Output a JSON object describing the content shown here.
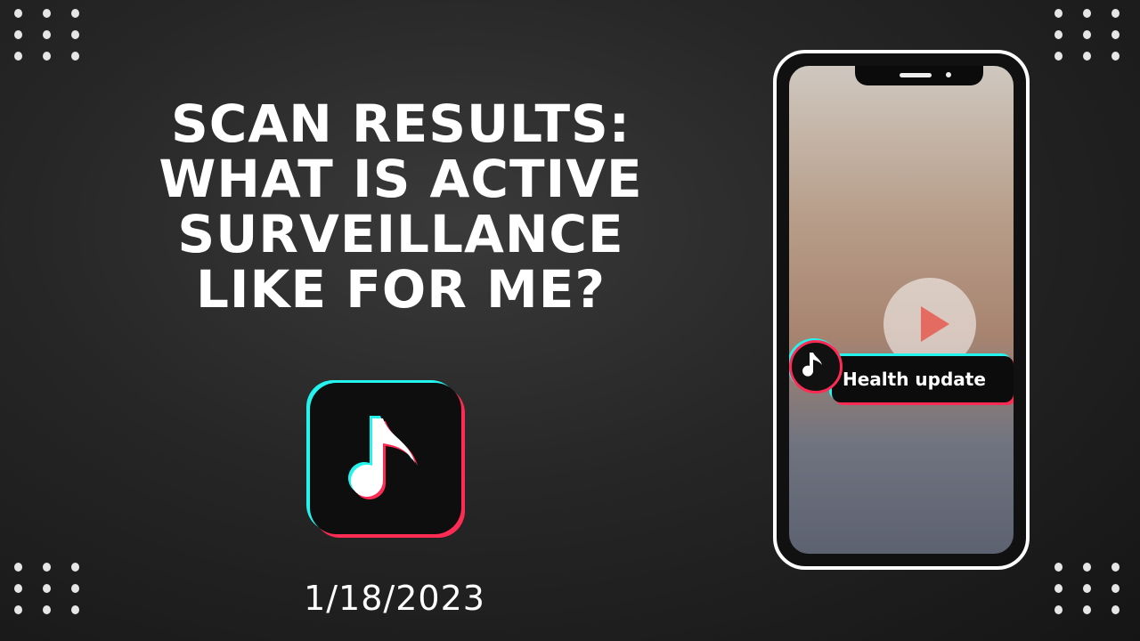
{
  "headline": {
    "lines": [
      "SCAN RESULTS:",
      "WHAT IS ACTIVE",
      "SURVEILLANCE",
      "LIKE FOR ME?"
    ]
  },
  "date": "1/18/2023",
  "phone": {
    "caption": "Health update"
  },
  "icons": {
    "app": "tiktok-logo-icon",
    "play": "play-icon",
    "caption_logo": "tiktok-logo-icon"
  },
  "colors": {
    "cyan": "#25f4ee",
    "pink": "#fe2c55",
    "text": "#ffffff"
  }
}
